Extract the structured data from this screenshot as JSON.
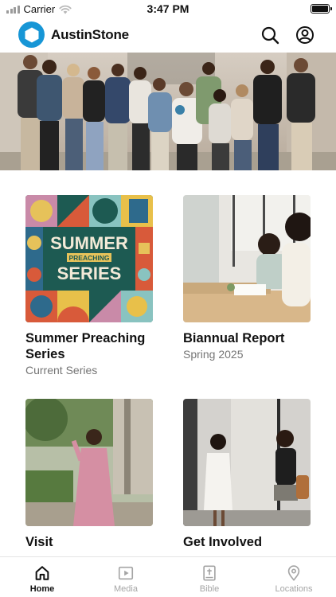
{
  "status_bar": {
    "carrier": "Carrier",
    "time": "3:47 PM"
  },
  "header": {
    "app_name": "AustinStone",
    "brand_color": "#1796d6",
    "icons": [
      "search-icon",
      "account-icon"
    ]
  },
  "hero": {
    "image": "group-photo"
  },
  "cards": [
    {
      "title": "Summer Preaching Series",
      "subtitle": "Current Series",
      "art_text": [
        "SUMMER",
        "PREACHING",
        "SERIES"
      ]
    },
    {
      "title": "Biannual Report",
      "subtitle": "Spring 2025"
    },
    {
      "title": "Visit",
      "subtitle": ""
    },
    {
      "title": "Get Involved",
      "subtitle": ""
    }
  ],
  "tab_bar": {
    "active_color": "#111111",
    "inactive_color": "#a5a5a5",
    "tabs": [
      {
        "label": "Home",
        "icon": "home-icon",
        "active": true
      },
      {
        "label": "Media",
        "icon": "media-icon",
        "active": false
      },
      {
        "label": "Bible",
        "icon": "bible-icon",
        "active": false
      },
      {
        "label": "Locations",
        "icon": "location-pin-icon",
        "active": false
      }
    ]
  }
}
